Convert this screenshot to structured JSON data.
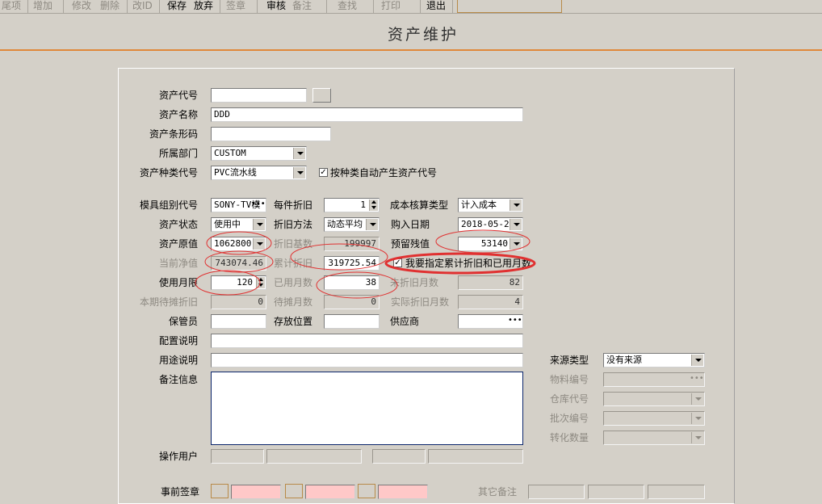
{
  "toolbar": {
    "tail": "尾项",
    "add": "增加",
    "modify": "修改",
    "delete": "删除",
    "change_id": "改ID",
    "save": "保存",
    "discard": "放弃",
    "sign": "签章",
    "audit": "审核",
    "remark": "备注",
    "search": "查找",
    "print": "打印",
    "exit": "退出"
  },
  "title": "资产维护",
  "labels": {
    "asset_code": "资产代号",
    "asset_name": "资产名称",
    "asset_barcode": "资产条形码",
    "department": "所属部门",
    "category_code": "资产种类代号",
    "auto_code": "按种类自动产生资产代号",
    "mold_group": "模具组别代号",
    "depreciation_per": "每件折旧",
    "cost_type": "成本核算类型",
    "asset_status": "资产状态",
    "depreciation_method": "折旧方法",
    "purchase_date": "购入日期",
    "original_value": "资产原值",
    "depreciation_base": "折旧基数",
    "residual_value": "预留残值",
    "net_value": "当前净值",
    "accumulated_depreciation": "累计折旧",
    "specify_accumulated": "我要指定累计折旧和已用月数",
    "usage_months": "使用月限",
    "used_months": "已用月数",
    "undepreciated_months": "未折旧月数",
    "pending_amortization": "本期待摊折旧",
    "pending_months": "待摊月数",
    "actual_months": "实际折旧月数",
    "custodian": "保管员",
    "storage_location": "存放位置",
    "supplier": "供应商",
    "config_desc": "配置说明",
    "usage_desc": "用途说明",
    "source_type": "来源类型",
    "remark_info": "备注信息",
    "material_no": "物料编号",
    "warehouse_code": "仓库代号",
    "batch_no": "批次编号",
    "conversion_qty": "转化数量",
    "operator": "操作用户",
    "pre_sign": "事前签章",
    "other_remark": "其它备注"
  },
  "values": {
    "asset_code": "",
    "asset_name": "DDD",
    "asset_barcode": "",
    "department": "CUSTOM",
    "category_code": "PVC流水线",
    "auto_code_checked": true,
    "mold_group": "SONY-TV模",
    "depreciation_per": "1",
    "cost_type": "计入成本",
    "asset_status": "使用中",
    "depreciation_method": "动态平均",
    "purchase_date": "2018-05-23",
    "original_value": "1062800",
    "depreciation_base": "199997",
    "residual_value": "53140",
    "net_value": "743074.46",
    "accumulated_depreciation": "319725.54",
    "specify_checked": true,
    "usage_months": "120",
    "used_months": "38",
    "undepreciated_months": "82",
    "pending_amortization": "0",
    "pending_months": "0",
    "actual_months": "4",
    "custodian": "",
    "storage_location": "",
    "supplier": "",
    "config_desc": "",
    "usage_desc": "",
    "source_type": "没有来源",
    "remark_info": "",
    "material_no": "",
    "warehouse_code": "",
    "batch_no": "",
    "conversion_qty": ""
  },
  "colors": {
    "background": "#d4d0c8",
    "title_rule": "#e0883a",
    "annotation_red": "#e03030",
    "pink_field": "#ffc8c8"
  },
  "icons": {
    "dropdown": "chevron-down-icon",
    "spinner": "spinner-icon",
    "ellipsis": "ellipsis-icon",
    "check": "checkbox-icon"
  }
}
